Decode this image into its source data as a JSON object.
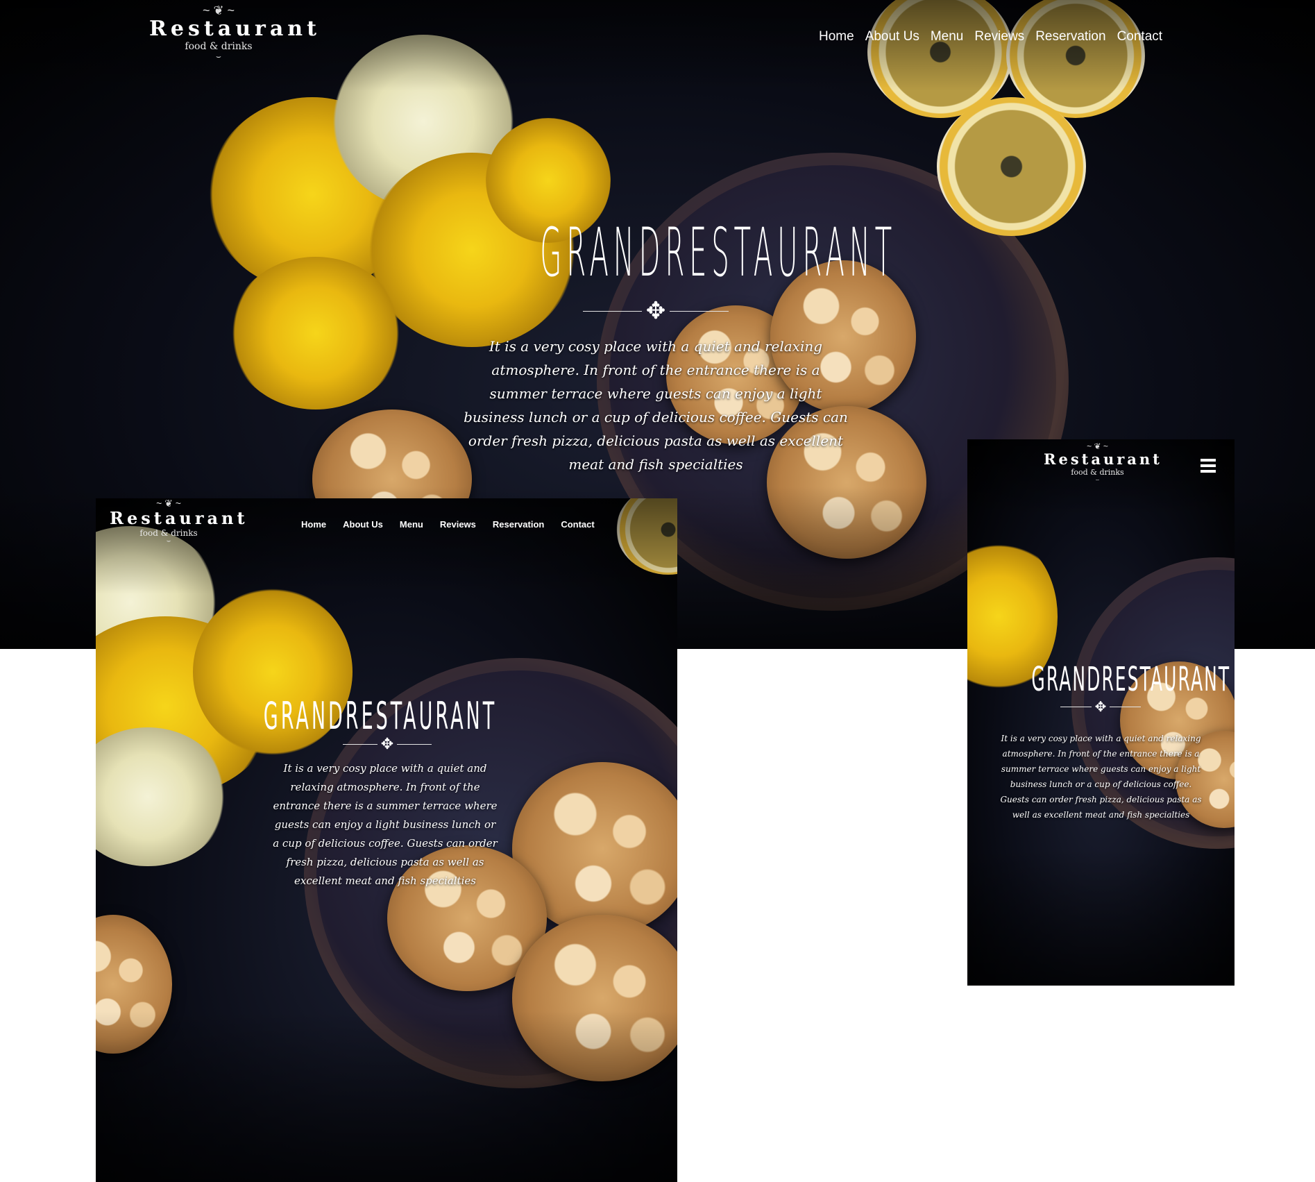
{
  "brand": {
    "name": "Restaurant",
    "tagline": "food & drinks"
  },
  "nav": {
    "items": [
      "Home",
      "About Us",
      "Menu",
      "Reviews",
      "Reservation",
      "Contact"
    ]
  },
  "hero": {
    "title": "GRANDRESTAURANT",
    "description": "It is a very cosy place with a quiet and relaxing atmosphere. In front of the entrance there is a summer terrace where guests can enjoy a light business lunch or a cup of delicious coffee. Guests can order fresh pizza, delicious pasta as well as excellent meat and fish specialties"
  },
  "icons": {
    "menu": "hamburger-menu-icon",
    "ornament": "knot-ornament-icon"
  },
  "colors": {
    "text": "#ffffff",
    "background": "#0b0d16",
    "accent_yellow": "#f6d51a",
    "page": "#ffffff"
  }
}
